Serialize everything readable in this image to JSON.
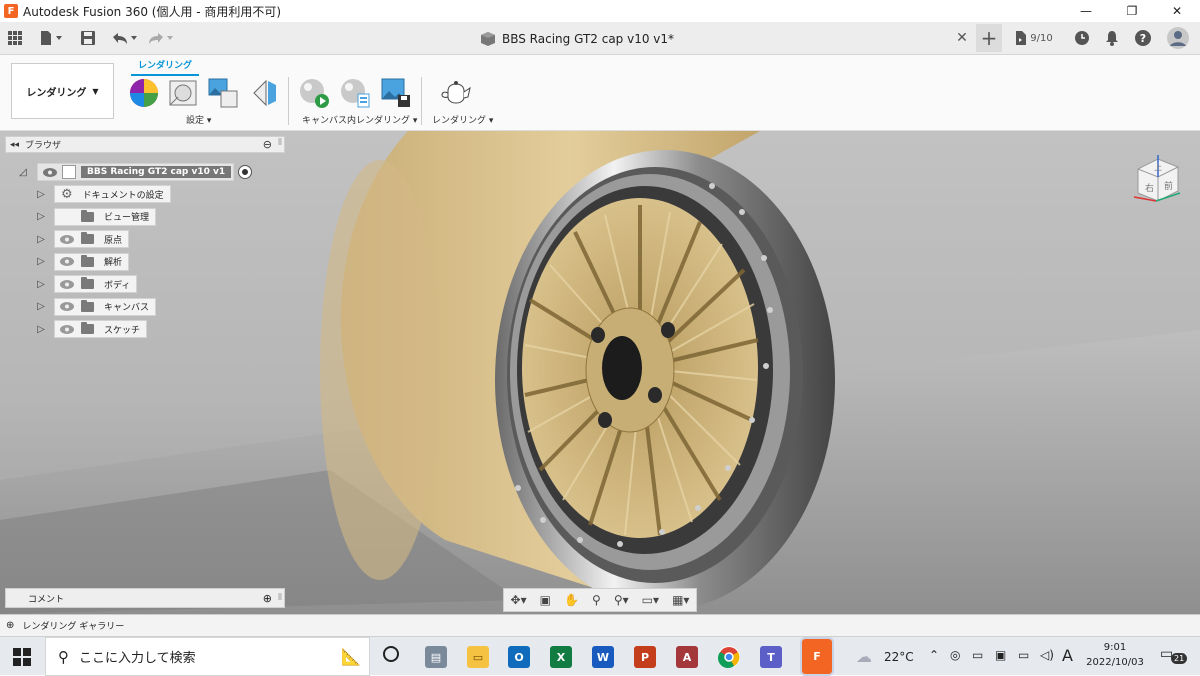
{
  "window": {
    "title": "Autodesk Fusion 360 (個人用 - 商用利用不可)",
    "app_icon_letter": "F",
    "minimize": "—",
    "maximize": "❐",
    "close": "✕"
  },
  "tabbar": {
    "doc_title": "BBS Racing GT2 cap v10 v1*",
    "close_tab": "✕",
    "new_tab": "+",
    "job_count": "9/10"
  },
  "toolbar": {
    "workspace_label": "レンダリング",
    "ribbon_tab": "レンダリング",
    "groups": {
      "setup": "設定",
      "incanvas": "キャンバス内レンダリング",
      "render": "レンダリング"
    }
  },
  "browser": {
    "title": "ブラウザ",
    "root": "BBS Racing GT2 cap v10 v1",
    "items": [
      {
        "label": "ドキュメントの設定",
        "icon": "gear-icon",
        "eye": false
      },
      {
        "label": "ビュー管理",
        "icon": "folder-icon",
        "eye": false
      },
      {
        "label": "原点",
        "icon": "folder-icon",
        "eye": true
      },
      {
        "label": "解析",
        "icon": "folder-icon",
        "eye": true
      },
      {
        "label": "ボディ",
        "icon": "folder-icon",
        "eye": true
      },
      {
        "label": "キャンバス",
        "icon": "folder-icon",
        "eye": true
      },
      {
        "label": "スケッチ",
        "icon": "folder-icon",
        "eye": true
      }
    ]
  },
  "viewcube": {
    "right": "右",
    "front": "前",
    "top": "上"
  },
  "comment": {
    "label": "コメント"
  },
  "gallery": {
    "label": "レンダリング ギャラリー"
  },
  "taskbar": {
    "search_placeholder": "ここに入力して検索",
    "weather": "22°C",
    "ime": "A",
    "time": "9:01",
    "date": "2022/10/03",
    "notifications": "21",
    "apps": [
      {
        "name": "outlook",
        "letter": "O",
        "color": "#0f6cbd"
      },
      {
        "name": "excel",
        "letter": "X",
        "color": "#107c41"
      },
      {
        "name": "word",
        "letter": "W",
        "color": "#185abd"
      },
      {
        "name": "powerpoint",
        "letter": "P",
        "color": "#c43e1c"
      },
      {
        "name": "access",
        "letter": "A",
        "color": "#a4373a"
      },
      {
        "name": "teams",
        "letter": "T",
        "color": "#5b5fc7"
      },
      {
        "name": "fusion",
        "letter": "F",
        "color": "#f26522"
      }
    ]
  },
  "colors": {
    "accent": "#0696d7",
    "wheel_gold": "#c9b27a",
    "tire": "#d8bf8c"
  }
}
